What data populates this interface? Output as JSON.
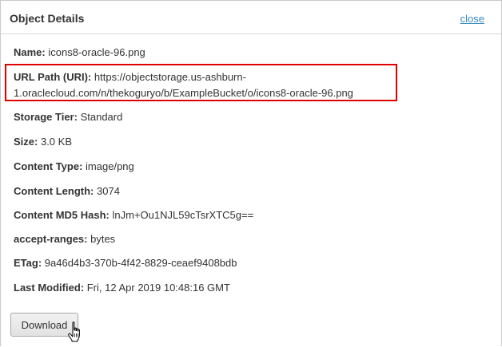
{
  "header": {
    "title": "Object Details",
    "close_label": "close"
  },
  "details": {
    "name": {
      "label": "Name:",
      "value": "icons8-oracle-96.png"
    },
    "url_path": {
      "label": "URL Path (URI):",
      "value": "https://objectstorage.us-ashburn-1.oraclecloud.com/n/thekoguryo/b/ExampleBucket/o/icons8-oracle-96.png"
    },
    "storage_tier": {
      "label": "Storage Tier:",
      "value": "Standard"
    },
    "size": {
      "label": "Size:",
      "value": "3.0 KB"
    },
    "content_type": {
      "label": "Content Type:",
      "value": "image/png"
    },
    "content_length": {
      "label": "Content Length:",
      "value": "3074"
    },
    "content_md5": {
      "label": "Content MD5 Hash:",
      "value": "lnJm+Ou1NJL59cTsrXTC5g=="
    },
    "accept_ranges": {
      "label": "accept-ranges:",
      "value": "bytes"
    },
    "etag": {
      "label": "ETag:",
      "value": "9a46d4b3-370b-4f42-8829-ceaef9408bdb"
    },
    "last_modified": {
      "label": "Last Modified:",
      "value": "Fri, 12 Apr 2019 10:48:16 GMT"
    }
  },
  "actions": {
    "download_label": "Download"
  },
  "icons": {
    "cursor": "hand-pointer-cursor-icon"
  },
  "colors": {
    "link": "#3a8bbf",
    "highlight_border": "#e00000"
  }
}
